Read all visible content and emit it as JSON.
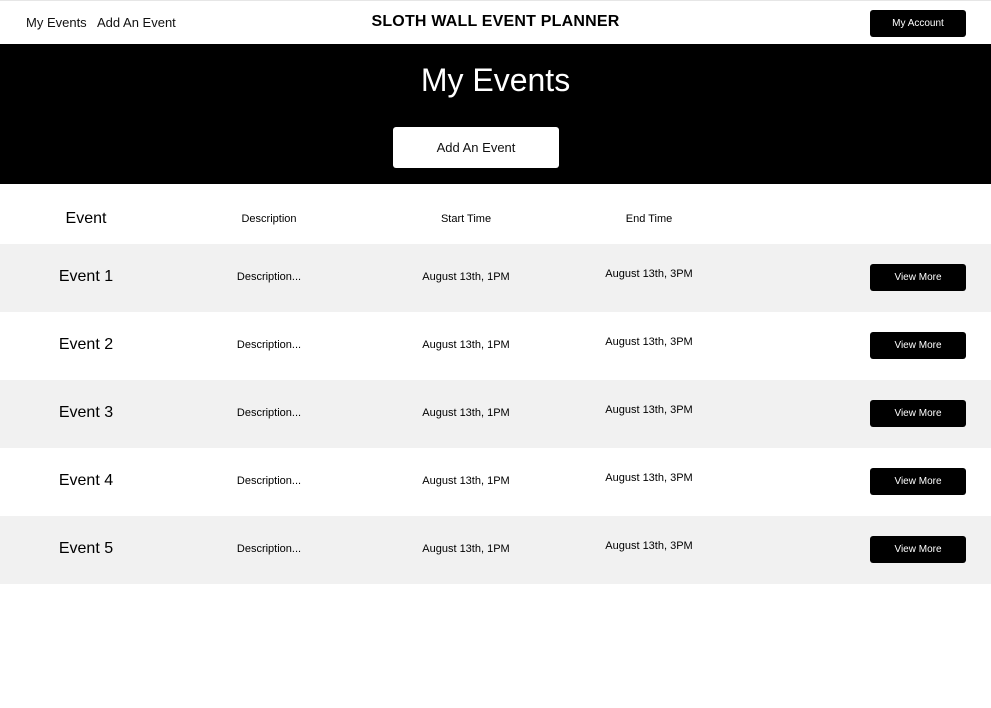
{
  "nav": {
    "my_events": "My Events",
    "add_event": "Add An Event",
    "title": "SLOTH WALL EVENT PLANNER",
    "account_button": "My Account"
  },
  "hero": {
    "title": "My Events",
    "add_button": "Add An Event"
  },
  "table": {
    "headers": {
      "event": "Event",
      "description": "Description",
      "start_time": "Start Time",
      "end_time": "End Time"
    },
    "rows": [
      {
        "name": "Event 1",
        "description": "Description...",
        "start": "August 13th, 1PM",
        "end": "August 13th, 3PM",
        "button": "View More"
      },
      {
        "name": "Event 2",
        "description": "Description...",
        "start": "August 13th, 1PM",
        "end": "August 13th, 3PM",
        "button": "View More"
      },
      {
        "name": "Event 3",
        "description": "Description...",
        "start": "August 13th, 1PM",
        "end": "August 13th, 3PM",
        "button": "View More"
      },
      {
        "name": "Event 4",
        "description": "Description...",
        "start": "August 13th, 1PM",
        "end": "August 13th, 3PM",
        "button": "View More"
      },
      {
        "name": "Event 5",
        "description": "Description...",
        "start": "August 13th, 1PM",
        "end": "August 13th, 3PM",
        "button": "View More"
      }
    ]
  },
  "colors": {
    "primary": "#000000",
    "row_shade": "#f1f1f1",
    "background": "#ffffff"
  }
}
